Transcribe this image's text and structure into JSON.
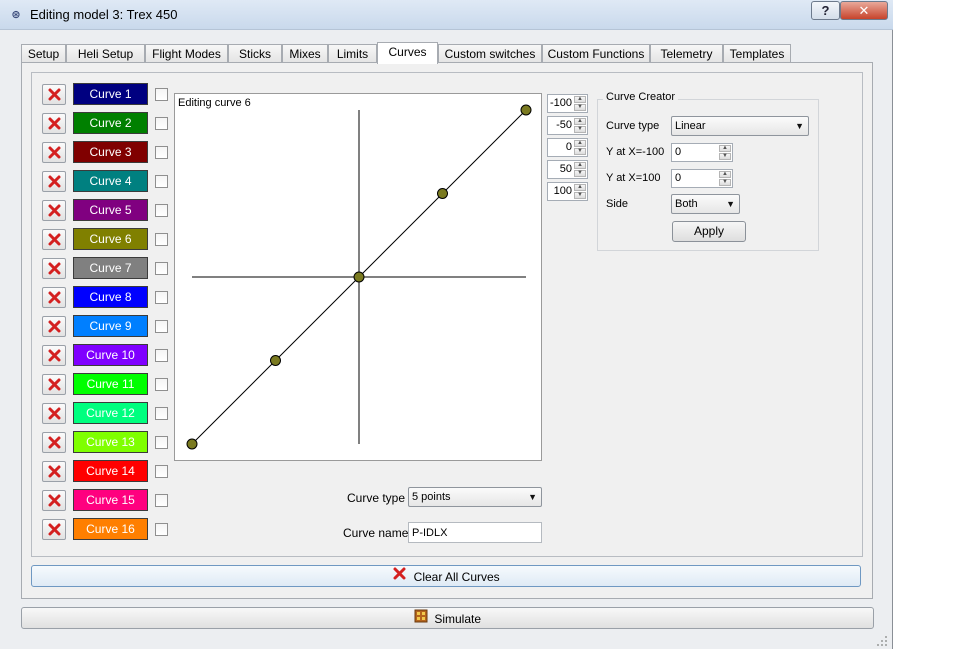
{
  "window": {
    "title": "Editing model 3: Trex 450",
    "help_label": "?",
    "close_label": "✕"
  },
  "tabs": [
    {
      "label": "Setup"
    },
    {
      "label": "Heli Setup"
    },
    {
      "label": "Flight Modes"
    },
    {
      "label": "Sticks"
    },
    {
      "label": "Mixes"
    },
    {
      "label": "Limits"
    },
    {
      "label": "Curves",
      "active": true
    },
    {
      "label": "Custom switches"
    },
    {
      "label": "Custom Functions"
    },
    {
      "label": "Telemetry"
    },
    {
      "label": "Templates"
    }
  ],
  "curves": [
    {
      "label": "Curve 1",
      "color": "#000080",
      "text": "#ffffff"
    },
    {
      "label": "Curve 2",
      "color": "#008000",
      "text": "#ffffff"
    },
    {
      "label": "Curve 3",
      "color": "#800000",
      "text": "#ffffff"
    },
    {
      "label": "Curve 4",
      "color": "#008080",
      "text": "#ffffff"
    },
    {
      "label": "Curve 5",
      "color": "#800080",
      "text": "#ffffff"
    },
    {
      "label": "Curve 6",
      "color": "#808000",
      "text": "#ffffff"
    },
    {
      "label": "Curve 7",
      "color": "#808080",
      "text": "#ffffff"
    },
    {
      "label": "Curve 8",
      "color": "#0000ff",
      "text": "#ffffff"
    },
    {
      "label": "Curve 9",
      "color": "#007fff",
      "text": "#ffffff"
    },
    {
      "label": "Curve 10",
      "color": "#7f00ff",
      "text": "#ffffff"
    },
    {
      "label": "Curve 11",
      "color": "#00ff00",
      "text": "#ffffff"
    },
    {
      "label": "Curve 12",
      "color": "#00ff7f",
      "text": "#ffffff"
    },
    {
      "label": "Curve 13",
      "color": "#7fff00",
      "text": "#ffffff"
    },
    {
      "label": "Curve 14",
      "color": "#ff0000",
      "text": "#ffffff"
    },
    {
      "label": "Curve 15",
      "color": "#ff007f",
      "text": "#ffffff"
    },
    {
      "label": "Curve 16",
      "color": "#ff7f00",
      "text": "#ffffff"
    }
  ],
  "editor": {
    "title": "Editing curve 6",
    "point_values": [
      -100,
      -50,
      0,
      50,
      100
    ],
    "point_color": "#7a7a20",
    "curve_type_label": "Curve type",
    "curve_type_value": "5 points",
    "curve_name_label": "Curve name",
    "curve_name_value": "P-IDLX"
  },
  "creator": {
    "title": "Curve Creator",
    "type_label": "Curve type",
    "type_value": "Linear",
    "y_min_label": "Y at X=-100",
    "y_min_value": "0",
    "y_max_label": "Y at X=100",
    "y_max_value": "0",
    "side_label": "Side",
    "side_value": "Both",
    "apply_label": "Apply"
  },
  "clear_all_label": "Clear All Curves",
  "simulate_label": "Simulate"
}
